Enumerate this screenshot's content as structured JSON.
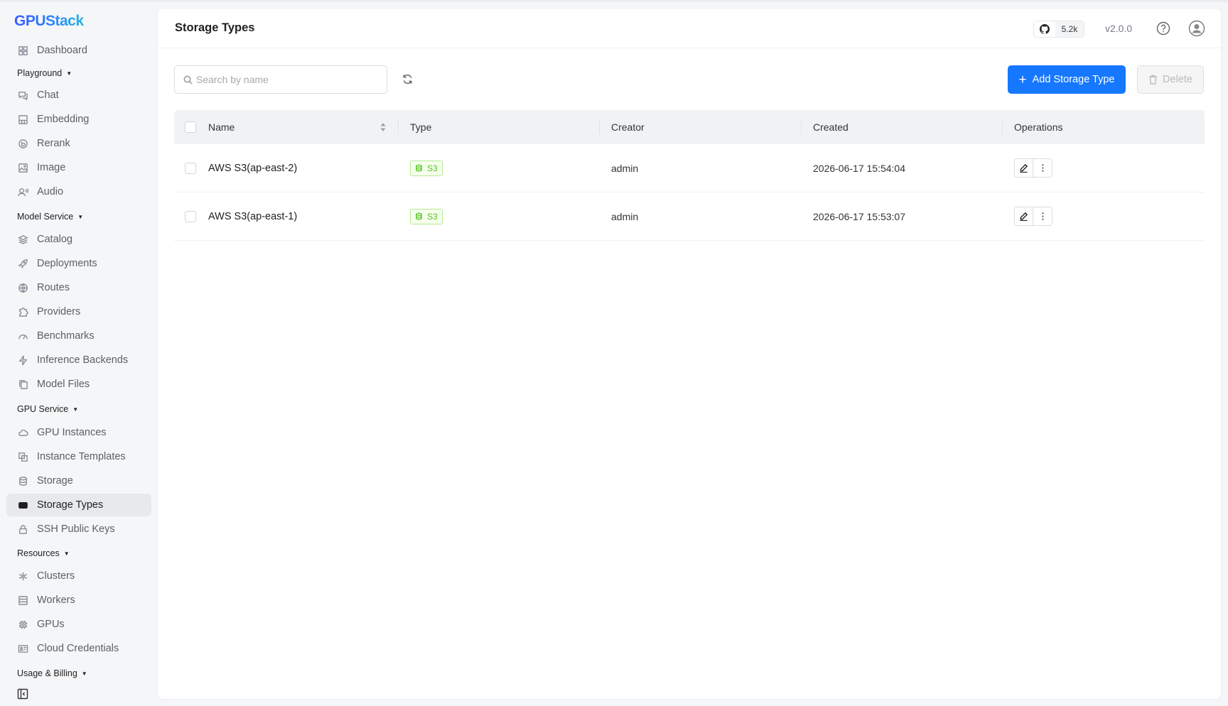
{
  "app": {
    "logo": "GPUStack"
  },
  "sidebar": {
    "items": [
      {
        "key": "dashboard",
        "label": "Dashboard",
        "icon": "grid-icon"
      },
      {
        "key": "group-playground",
        "label": "Playground",
        "group": true
      },
      {
        "key": "chat",
        "label": "Chat",
        "icon": "chat-icon"
      },
      {
        "key": "embedding",
        "label": "Embedding",
        "icon": "embedding-icon"
      },
      {
        "key": "rerank",
        "label": "Rerank",
        "icon": "rerank-icon"
      },
      {
        "key": "image",
        "label": "Image",
        "icon": "image-icon"
      },
      {
        "key": "audio",
        "label": "Audio",
        "icon": "audio-icon"
      },
      {
        "key": "group-model-service",
        "label": "Model Service",
        "group": true
      },
      {
        "key": "catalog",
        "label": "Catalog",
        "icon": "layers-icon"
      },
      {
        "key": "deployments",
        "label": "Deployments",
        "icon": "rocket-icon"
      },
      {
        "key": "routes",
        "label": "Routes",
        "icon": "globe-icon"
      },
      {
        "key": "providers",
        "label": "Providers",
        "icon": "puzzle-icon"
      },
      {
        "key": "benchmarks",
        "label": "Benchmarks",
        "icon": "gauge-icon"
      },
      {
        "key": "inference-backends",
        "label": "Inference Backends",
        "icon": "bolt-icon"
      },
      {
        "key": "model-files",
        "label": "Model Files",
        "icon": "files-icon"
      },
      {
        "key": "group-gpu-service",
        "label": "GPU Service",
        "group": true
      },
      {
        "key": "gpu-instances",
        "label": "GPU Instances",
        "icon": "cloud-icon"
      },
      {
        "key": "instance-templates",
        "label": "Instance Templates",
        "icon": "template-icon"
      },
      {
        "key": "storage",
        "label": "Storage",
        "icon": "database-icon"
      },
      {
        "key": "storage-types",
        "label": "Storage Types",
        "icon": "drive-icon",
        "active": true
      },
      {
        "key": "ssh-public-keys",
        "label": "SSH Public Keys",
        "icon": "lock-icon"
      },
      {
        "key": "group-resources",
        "label": "Resources",
        "group": true
      },
      {
        "key": "clusters",
        "label": "Clusters",
        "icon": "cluster-icon"
      },
      {
        "key": "workers",
        "label": "Workers",
        "icon": "server-icon"
      },
      {
        "key": "gpus",
        "label": "GPUs",
        "icon": "chip-icon"
      },
      {
        "key": "cloud-credentials",
        "label": "Cloud Credentials",
        "icon": "id-card-icon"
      },
      {
        "key": "group-usage-billing",
        "label": "Usage & Billing",
        "group": true
      }
    ]
  },
  "header": {
    "title": "Storage Types",
    "github_stars": "5.2k",
    "version": "v2.0.0"
  },
  "toolbar": {
    "search_placeholder": "Search by name",
    "add_label": "Add Storage Type",
    "delete_label": "Delete"
  },
  "table": {
    "columns": [
      "Name",
      "Type",
      "Creator",
      "Created",
      "Operations"
    ],
    "rows": [
      {
        "name": "AWS S3(ap-east-2)",
        "type": "S3",
        "creator": "admin",
        "created": "2026-06-17 15:54:04"
      },
      {
        "name": "AWS S3(ap-east-1)",
        "type": "S3",
        "creator": "admin",
        "created": "2026-06-17 15:53:07"
      }
    ]
  },
  "colors": {
    "primary": "#1677ff",
    "tag_green": "#52c41a",
    "active_nav_bg": "#e8e9ed"
  }
}
